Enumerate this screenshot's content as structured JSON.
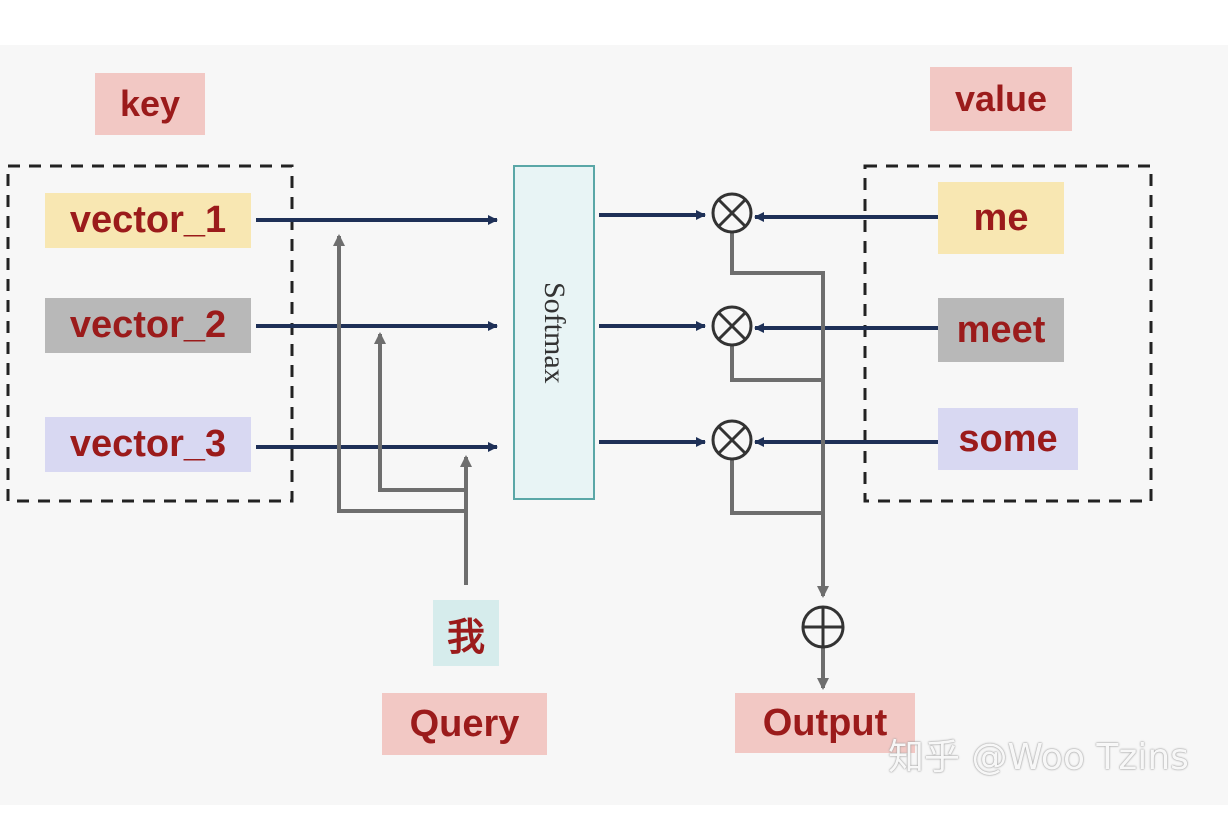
{
  "key": {
    "title": "key",
    "vectors": [
      "vector_1",
      "vector_2",
      "vector_3"
    ]
  },
  "value": {
    "title": "value",
    "items": [
      "me",
      "meet",
      "some"
    ]
  },
  "softmax": "Softmax",
  "query": {
    "token": "我",
    "label": "Query"
  },
  "output": "Output",
  "watermark": "知乎 @Woo Tzins",
  "colors": {
    "label_text": "#9b1b1b",
    "title_bg": "#f2c8c4",
    "row1_bg": "#f8e7b2",
    "row2_bg": "#b8b8b8",
    "row3_bg": "#d8d8f2",
    "token_bg": "#d6ecec",
    "navy_arrow": "#1e3057",
    "gray_line": "#6e6e6e",
    "softmax_fill": "#e8f4f5",
    "softmax_border": "#5aa7a7"
  }
}
